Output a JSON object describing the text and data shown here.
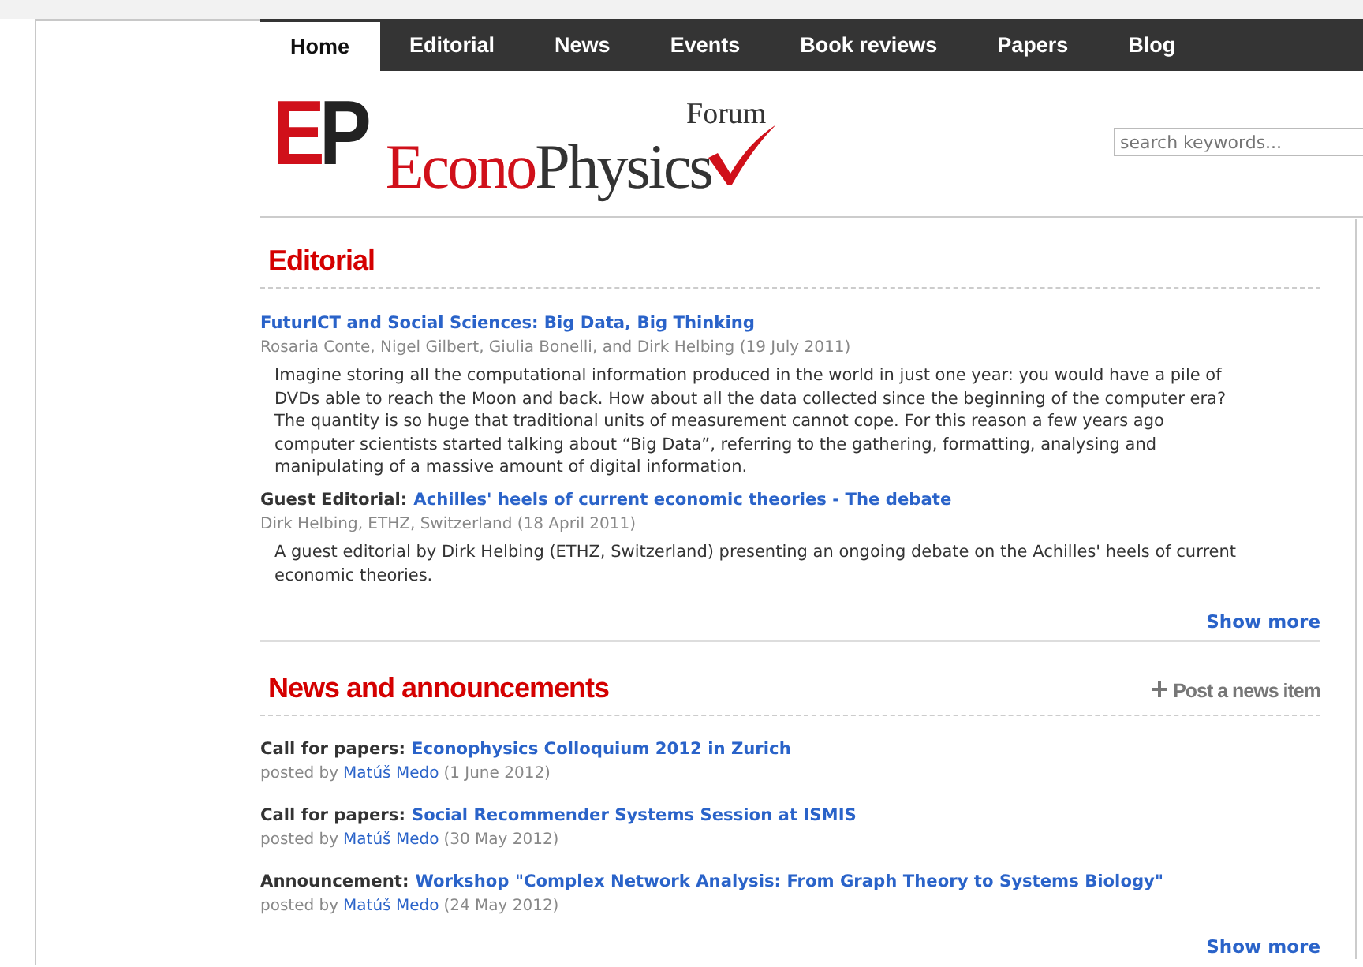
{
  "nav": {
    "tabs": [
      {
        "label": "Home",
        "selected": true
      },
      {
        "label": "Editorial",
        "selected": false
      },
      {
        "label": "News",
        "selected": false
      },
      {
        "label": "Events",
        "selected": false
      },
      {
        "label": "Book reviews",
        "selected": false
      },
      {
        "label": "Papers",
        "selected": false
      },
      {
        "label": "Blog",
        "selected": false
      }
    ]
  },
  "logo": {
    "mark_left": "E",
    "mark_right": "P",
    "word_left": "Econo",
    "word_right": "Physics",
    "suffix": "Forum"
  },
  "search": {
    "placeholder": "search keywords..."
  },
  "editorial": {
    "heading": "Editorial",
    "items": [
      {
        "title": "FuturICT and Social Sciences: Big Data, Big Thinking",
        "meta": "Rosaria Conte, Nigel Gilbert, Giulia Bonelli, and Dirk Helbing (19 July 2011)",
        "summary": "Imagine storing all the computational information produced in the world in just one year: you would have a pile of DVDs able to reach the Moon and back. How about all the data collected since the beginning of the computer era? The quantity is so huge that traditional units of measurement cannot cope. For this reason a few years ago computer scientists started talking about “Big Data”, referring to the gathering, formatting, analysing and manipulating of a massive amount of digital information."
      },
      {
        "prefix": "Guest Editorial:",
        "title": "Achilles' heels of current economic theories - The debate",
        "meta": "Dirk Helbing, ETHZ, Switzerland (18 April 2011)",
        "summary": "A guest editorial by Dirk Helbing (ETHZ, Switzerland) presenting an ongoing debate on the Achilles' heels of current economic theories."
      }
    ],
    "show_more": "Show more"
  },
  "news": {
    "heading": "News and announcements",
    "post_link": "Post a news item",
    "items": [
      {
        "prefix": "Call for papers:",
        "title": "Econophysics Colloquium 2012 in Zurich",
        "posted_by": "posted by",
        "author": "Matúš Medo",
        "date": "(1 June 2012)"
      },
      {
        "prefix": "Call for papers:",
        "title": "Social Recommender Systems Session at ISMIS",
        "posted_by": "posted by",
        "author": "Matúš Medo",
        "date": "(30 May 2012)"
      },
      {
        "prefix": "Announcement:",
        "title": "Workshop \"Complex Network Analysis: From Graph Theory to Systems Biology\"",
        "posted_by": "posted by",
        "author": "Matúš Medo",
        "date": "(24 May 2012)"
      }
    ],
    "show_more": "Show more"
  }
}
